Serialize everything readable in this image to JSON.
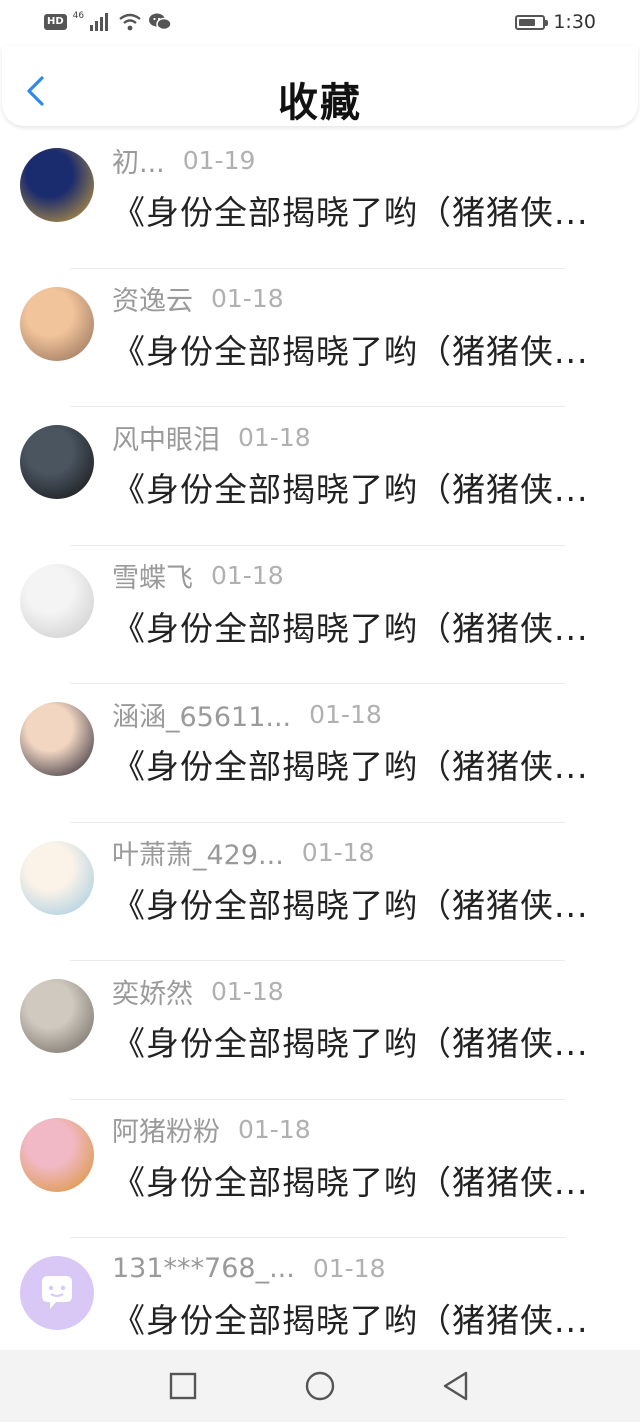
{
  "status_bar": {
    "hd": "HD",
    "network": "46",
    "time": "1:30",
    "battery_level": 0.7,
    "icons": [
      "signal-icon",
      "wifi-icon",
      "wechat-icon",
      "battery-icon"
    ]
  },
  "header": {
    "title": "收藏",
    "back_icon": "chevron-left-icon",
    "accent": "#2e8be6"
  },
  "items": [
    {
      "username": "初...",
      "date": "01-19",
      "content": "《身份全部揭晓了哟（猪猪侠...",
      "avatar_colors": [
        "#1a2b6e",
        "#d4a83a"
      ]
    },
    {
      "username": "资逸云",
      "date": "01-18",
      "content": "《身份全部揭晓了哟（猪猪侠...",
      "avatar_colors": [
        "#f2c49b",
        "#8b6a55"
      ]
    },
    {
      "username": "风中眼泪",
      "date": "01-18",
      "content": "《身份全部揭晓了哟（猪猪侠...",
      "avatar_colors": [
        "#4a5560",
        "#111111"
      ]
    },
    {
      "username": "雪蝶飞",
      "date": "01-18",
      "content": "《身份全部揭晓了哟（猪猪侠...",
      "avatar_colors": [
        "#f4f4f4",
        "#c8c8c8"
      ]
    },
    {
      "username": "涵涵_65611...",
      "date": "01-18",
      "content": "《身份全部揭晓了哟（猪猪侠...",
      "avatar_colors": [
        "#f2d6c2",
        "#1a1a2a"
      ]
    },
    {
      "username": "叶萧萧_429...",
      "date": "01-18",
      "content": "《身份全部揭晓了哟（猪猪侠...",
      "avatar_colors": [
        "#fbf3e8",
        "#9cc7e0"
      ]
    },
    {
      "username": "奕娇然",
      "date": "01-18",
      "content": "《身份全部揭晓了哟（猪猪侠...",
      "avatar_colors": [
        "#cfc9c0",
        "#6a625a"
      ]
    },
    {
      "username": "阿猪粉粉",
      "date": "01-18",
      "content": "《身份全部揭晓了哟（猪猪侠...",
      "avatar_colors": [
        "#f1b9c5",
        "#d8912a"
      ]
    },
    {
      "username": "131***768_...",
      "date": "01-18",
      "content": "《身份全部揭晓了哟（猪猪侠...",
      "avatar_colors": [
        "#d9c8f5",
        "#ffffff"
      ]
    }
  ],
  "nav_bar": {
    "icons": [
      "recent-apps-icon",
      "home-icon",
      "back-icon"
    ]
  }
}
